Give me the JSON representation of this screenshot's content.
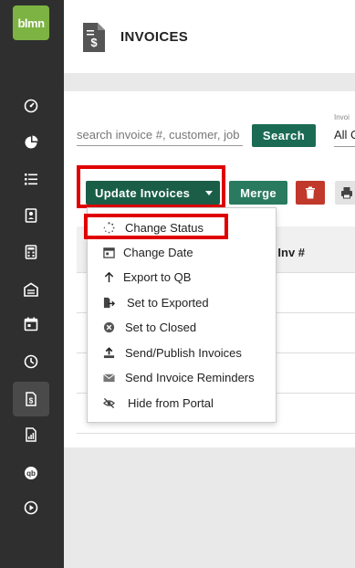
{
  "app": {
    "logo_text": "blmn"
  },
  "sidebar": {
    "items": [
      {
        "icon": "dashboard-icon"
      },
      {
        "icon": "pie-chart-icon"
      },
      {
        "icon": "list-icon"
      },
      {
        "icon": "contact-card-icon"
      },
      {
        "icon": "calculator-icon"
      },
      {
        "icon": "warehouse-icon"
      },
      {
        "icon": "calendar-icon"
      },
      {
        "icon": "clock-icon"
      },
      {
        "icon": "invoice-icon",
        "active": true
      },
      {
        "icon": "report-icon"
      },
      {
        "icon": "quickbooks-icon"
      },
      {
        "icon": "play-circle-icon"
      }
    ]
  },
  "header": {
    "title": "INVOICES",
    "icon": "invoice-document-icon"
  },
  "toolbar": {
    "search_placeholder": "search invoice #, customer, job",
    "search_label": "Search",
    "filter_label": "Invoi",
    "filter_value": "All C",
    "update_label": "Update Invoices",
    "merge_label": "Merge",
    "delete_icon": "trash-icon",
    "print_icon": "printer-icon"
  },
  "table": {
    "columns": [
      "cct Inv #"
    ]
  },
  "menu": {
    "items": [
      {
        "label": "Change Status",
        "icon": "spinner-icon"
      },
      {
        "label": "Change Date",
        "icon": "calendar-icon"
      },
      {
        "label": "Export to QB",
        "icon": "arrow-up-icon"
      },
      {
        "label": "Set to Exported",
        "icon": "export-file-icon"
      },
      {
        "label": "Set to Closed",
        "icon": "close-circle-icon"
      },
      {
        "label": "Send/Publish Invoices",
        "icon": "upload-icon"
      },
      {
        "label": "Send Invoice Reminders",
        "icon": "envelope-icon"
      },
      {
        "label": "Hide from Portal",
        "icon": "eye-slash-icon"
      }
    ]
  },
  "colors": {
    "primary_green": "#1b5e48",
    "sidebar_bg": "#2f2f2f",
    "logo_green": "#7cb342",
    "danger_red": "#c0392b",
    "highlight_red": "#e00000"
  }
}
